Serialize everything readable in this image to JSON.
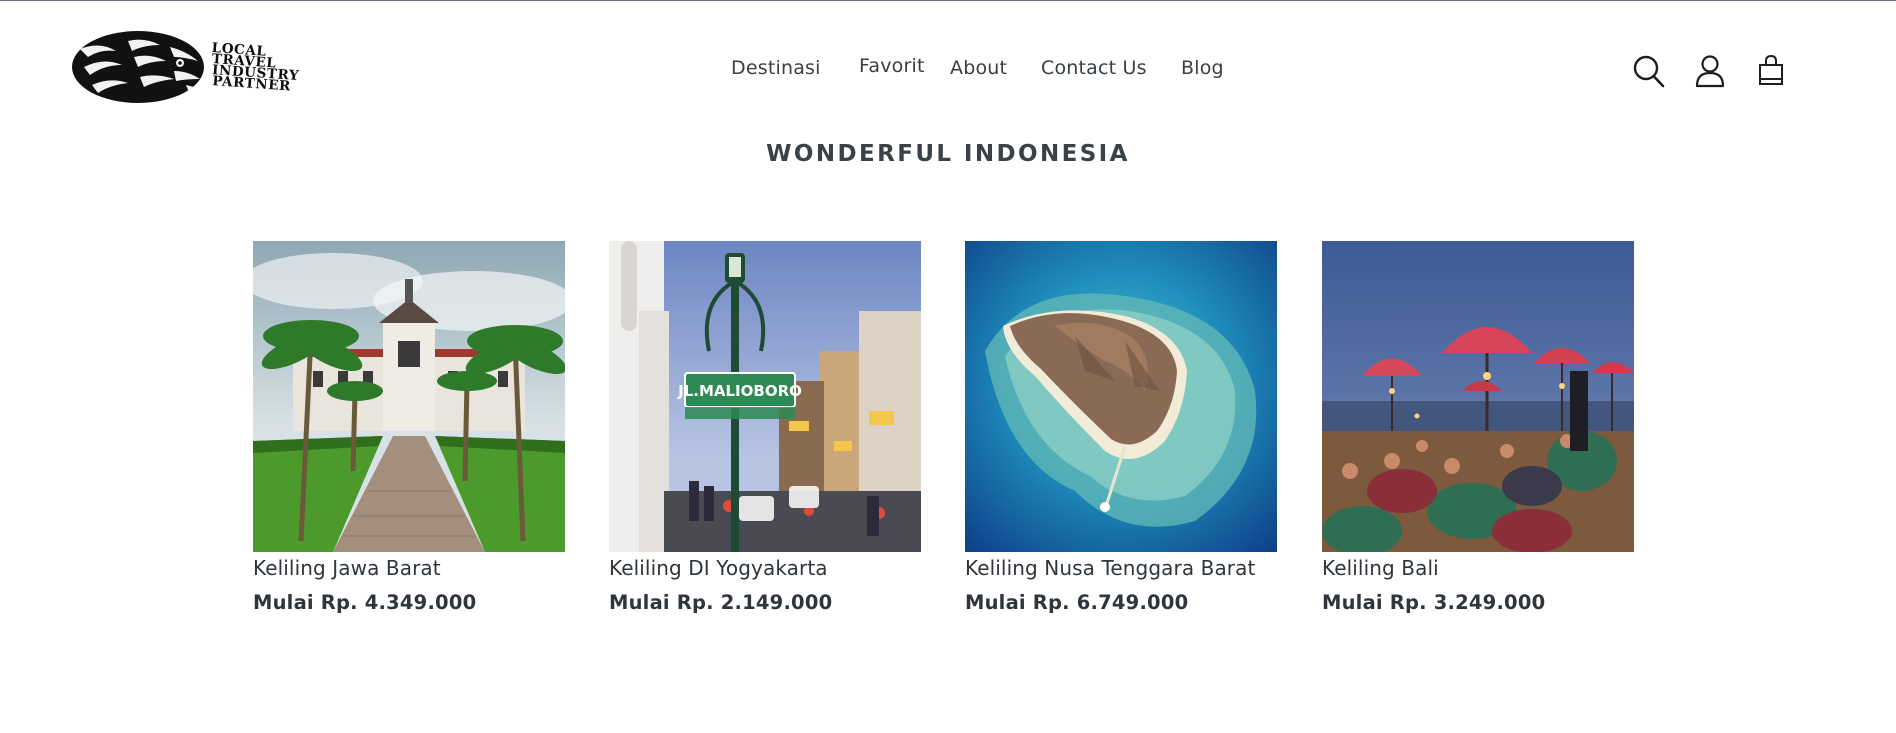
{
  "header": {
    "logo_lines": [
      "LOCAL",
      "TRAVEL",
      "INDUSTRY",
      "PARTNER"
    ],
    "nav": [
      {
        "label": "Destinasi"
      },
      {
        "label": "Favorit"
      },
      {
        "label": "About"
      },
      {
        "label": "Contact Us"
      },
      {
        "label": "Blog"
      }
    ],
    "icons": [
      "search-icon",
      "account-icon",
      "cart-icon"
    ]
  },
  "section": {
    "title": "WONDERFUL INDONESIA"
  },
  "products": [
    {
      "title": "Keliling Jawa Barat",
      "price": "Mulai Rp. 4.349.000",
      "image": "gedung-sate-photo"
    },
    {
      "title": "Keliling DI Yogyakarta",
      "price": "Mulai Rp. 2.149.000",
      "image": "malioboro-street-photo"
    },
    {
      "title": "Keliling Nusa Tenggara Barat",
      "price": "Mulai Rp. 6.749.000",
      "image": "island-aerial-photo"
    },
    {
      "title": "Keliling Bali",
      "price": "Mulai Rp. 3.249.000",
      "image": "bali-beach-night-photo"
    }
  ],
  "product_image_text": {
    "street_sign": "JL.MALIOBORO"
  },
  "colors": {
    "text": "#2e3438",
    "title": "#3a4148",
    "top_border": "#6b7480"
  }
}
